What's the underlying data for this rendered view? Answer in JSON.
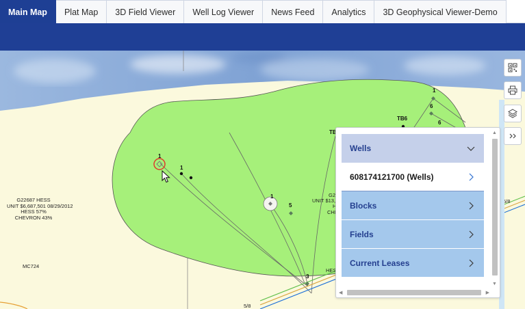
{
  "tabs": [
    {
      "label": "Main Map",
      "active": true
    },
    {
      "label": "Plat Map",
      "active": false
    },
    {
      "label": "3D Field Viewer",
      "active": false
    },
    {
      "label": "Well Log Viewer",
      "active": false
    },
    {
      "label": "News Feed",
      "active": false
    },
    {
      "label": "Analytics",
      "active": false
    },
    {
      "label": "3D Geophysical Viewer-Demo",
      "active": false
    }
  ],
  "colors": {
    "accent": "#1f3f95",
    "field_fill": "#a6f07a",
    "map_background": "#fbf9dd",
    "water": "#8fb0dc",
    "panel_header": "#c5d0ea",
    "panel_category": "#a4c8ec",
    "selection_ring": "#e03a2a"
  },
  "map": {
    "lease_labels": {
      "g22687_line1": "G22687 HESS",
      "g22687_line2": "UNIT $6,687,501 08/29/2012",
      "g22687_line3": "HESS 57%",
      "g22687_line4": "CHEVRON 43%",
      "mc724": "MC724",
      "partial_g2": "G2",
      "partial_unit": "UNIT $13,",
      "partial_h": "H",
      "partial_che": "CHE",
      "partial_hes": "HES",
      "partial_tb": "TB",
      "partial_58a": "5/8",
      "partial_58b": "5/8"
    },
    "well_labels": [
      "1",
      "1",
      "1",
      "1",
      "6",
      "TB6",
      "6",
      "5",
      "3"
    ]
  },
  "tools": [
    {
      "name": "qr-code-icon"
    },
    {
      "name": "print-icon"
    },
    {
      "name": "layers-icon"
    },
    {
      "name": "expand-icon"
    }
  ],
  "layer_panel": {
    "header": "Wells",
    "selected_item": "608174121700 (Wells)",
    "categories": [
      "Blocks",
      "Fields",
      "Current Leases"
    ]
  }
}
